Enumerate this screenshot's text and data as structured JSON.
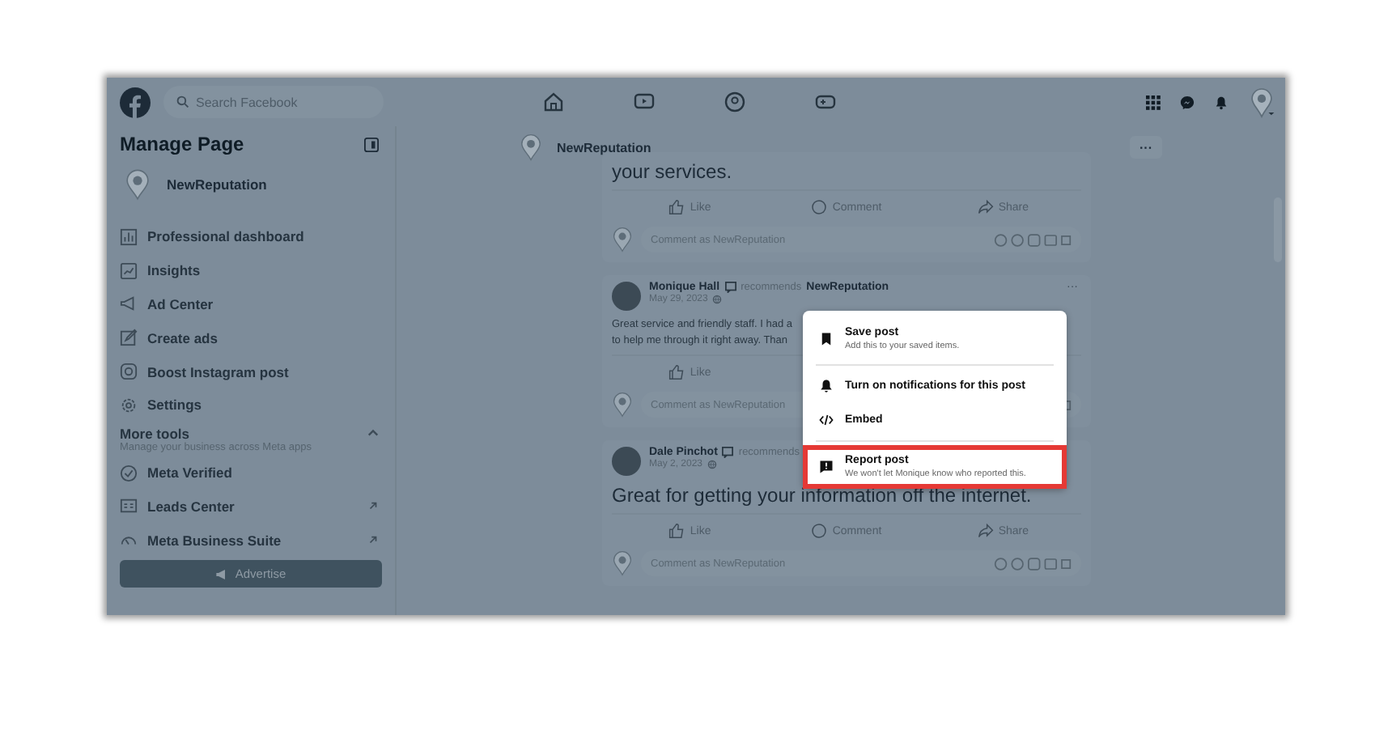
{
  "top_bar": {
    "search": {
      "placeholder": "Search Facebook"
    }
  },
  "sidebar": {
    "title": "Manage Page",
    "page_name": "NewReputation",
    "items": [
      {
        "label": "Professional dashboard",
        "external": false
      },
      {
        "label": "Insights",
        "external": false
      },
      {
        "label": "Ad Center",
        "external": false
      },
      {
        "label": "Create ads",
        "external": false
      },
      {
        "label": "Boost Instagram post",
        "external": false
      },
      {
        "label": "Settings",
        "external": false
      }
    ],
    "more_tools": {
      "title": "More tools",
      "subtitle": "Manage your business across Meta apps",
      "expanded": true,
      "items": [
        {
          "label": "Meta Verified",
          "external": false
        },
        {
          "label": "Leads Center",
          "external": true
        },
        {
          "label": "Meta Business Suite",
          "external": true
        }
      ]
    },
    "advertise_button": "Advertise"
  },
  "page_header": {
    "name": "NewReputation",
    "more": "···"
  },
  "posts": [
    {
      "text_lines": [
        "your services."
      ],
      "large": true,
      "actions": [
        "Like",
        "Comment",
        "Share"
      ],
      "comment_placeholder": "Comment as NewReputation"
    },
    {
      "author": "Monique Hall",
      "recommends": "recommends",
      "target": "NewReputation",
      "date": "May 29, 2023",
      "more": "···",
      "text_lines": [
        "Great service and friendly staff. I had a",
        "to help me through it right away. Than"
      ],
      "large": false,
      "actions": [
        "Like"
      ],
      "comment_placeholder": "Comment as NewReputation"
    },
    {
      "author": "Dale Pinchot",
      "recommends": "recommends",
      "date": "May 2, 2023",
      "text_lines": [
        "Great for getting your information off the internet."
      ],
      "large": true,
      "actions": [
        "Like",
        "Comment",
        "Share"
      ],
      "comment_placeholder": "Comment as NewReputation"
    }
  ],
  "menu": {
    "items": [
      {
        "kind": "bookmark",
        "label": "Save post",
        "sub": "Add this to your saved items.",
        "selected": false,
        "divider_after": true
      },
      {
        "kind": "bell",
        "label": "Turn on notifications for this post",
        "selected": false,
        "divider_after": false
      },
      {
        "kind": "code",
        "label": "Embed",
        "selected": false,
        "divider_after": true
      },
      {
        "kind": "flag",
        "label": "Report post",
        "sub": "We won't let Monique know who reported this.",
        "selected": true,
        "divider_after": false
      }
    ]
  }
}
